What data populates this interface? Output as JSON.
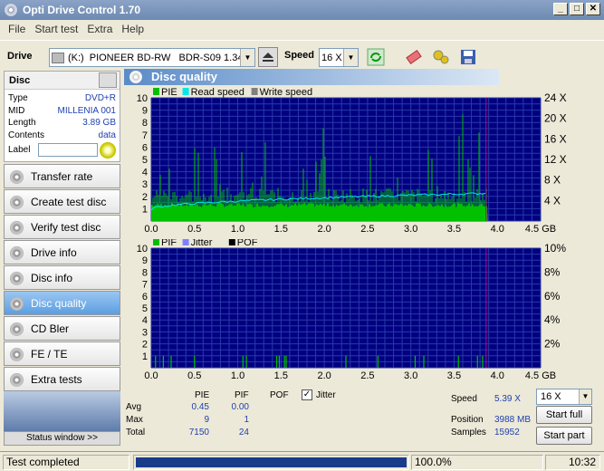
{
  "window": {
    "title": "Opti Drive Control 1.70"
  },
  "menu": [
    "File",
    "Start test",
    "Extra",
    "Help"
  ],
  "toolbar": {
    "drive_label": "Drive",
    "drive_letter": "(K:)",
    "drive_name": "PIONEER BD-RW   BDR-S09 1.34",
    "speed_label": "Speed",
    "speed_value": "16 X"
  },
  "disc": {
    "title": "Disc",
    "type_label": "Type",
    "type_value": "DVD+R",
    "mid_label": "MID",
    "mid_value": "MILLENIA 001",
    "length_label": "Length",
    "length_value": "3.89 GB",
    "contents_label": "Contents",
    "contents_value": "data",
    "label_label": "Label",
    "label_value": ""
  },
  "nav": [
    {
      "label": "Transfer rate",
      "active": false
    },
    {
      "label": "Create test disc",
      "active": false
    },
    {
      "label": "Verify test disc",
      "active": false
    },
    {
      "label": "Drive info",
      "active": false
    },
    {
      "label": "Disc info",
      "active": false
    },
    {
      "label": "Disc quality",
      "active": true
    },
    {
      "label": "CD Bler",
      "active": false
    },
    {
      "label": "FE / TE",
      "active": false
    },
    {
      "label": "Extra tests",
      "active": false
    }
  ],
  "status_window_btn": "Status window >>",
  "panel_title": "Disc quality",
  "chart_data": [
    {
      "type": "bar",
      "legend": [
        "PIE",
        "Read speed",
        "Write speed"
      ],
      "legend_colors": [
        "#00c000",
        "#00e8e8",
        "#808080"
      ],
      "x_ticks": [
        "0.0",
        "0.5",
        "1.0",
        "1.5",
        "2.0",
        "2.5",
        "3.0",
        "3.5",
        "4.0",
        "4.5 GB"
      ],
      "y_left_ticks": [
        "1",
        "2",
        "3",
        "4",
        "5",
        "6",
        "7",
        "8",
        "9",
        "10"
      ],
      "y_right_ticks": [
        "4 X",
        "8 X",
        "12 X",
        "16 X",
        "20 X",
        "24 X"
      ],
      "xlim": [
        0,
        4.5
      ],
      "ylim": [
        0,
        10
      ],
      "y2lim": [
        0,
        24
      ],
      "data_end_gb": 3.89,
      "pie_max": 9,
      "read_speed_start": 2.3,
      "read_speed_end": 5.4
    },
    {
      "type": "bar",
      "legend": [
        "PIF",
        "Jitter",
        "POF"
      ],
      "legend_colors": [
        "#00c000",
        "#8080ff",
        "#000000"
      ],
      "x_ticks": [
        "0.0",
        "0.5",
        "1.0",
        "1.5",
        "2.0",
        "2.5",
        "3.0",
        "3.5",
        "4.0",
        "4.5 GB"
      ],
      "y_left_ticks": [
        "1",
        "2",
        "3",
        "4",
        "5",
        "6",
        "7",
        "8",
        "9",
        "10"
      ],
      "y_right_ticks": [
        "2%",
        "4%",
        "6%",
        "8%",
        "10%"
      ],
      "xlim": [
        0,
        4.5
      ],
      "ylim": [
        0,
        10
      ],
      "pif_max": 1
    }
  ],
  "stats": {
    "col_pie": "PIE",
    "col_pif": "PIF",
    "col_pof": "POF",
    "col_jitter": "Jitter",
    "jitter_checked": true,
    "avg_label": "Avg",
    "avg_pie": "0.45",
    "avg_pif": "0.00",
    "max_label": "Max",
    "max_pie": "9",
    "max_pif": "1",
    "total_label": "Total",
    "total_pie": "7150",
    "total_pif": "24",
    "speed_label": "Speed",
    "speed_value": "5.39 X",
    "position_label": "Position",
    "position_value": "3988 MB",
    "samples_label": "Samples",
    "samples_value": "15952",
    "speed_select": "16 X",
    "start_full": "Start full",
    "start_part": "Start part"
  },
  "statusbar": {
    "status": "Test completed",
    "progress": 1.0,
    "progress_text": "100.0%",
    "time": "10:32"
  }
}
